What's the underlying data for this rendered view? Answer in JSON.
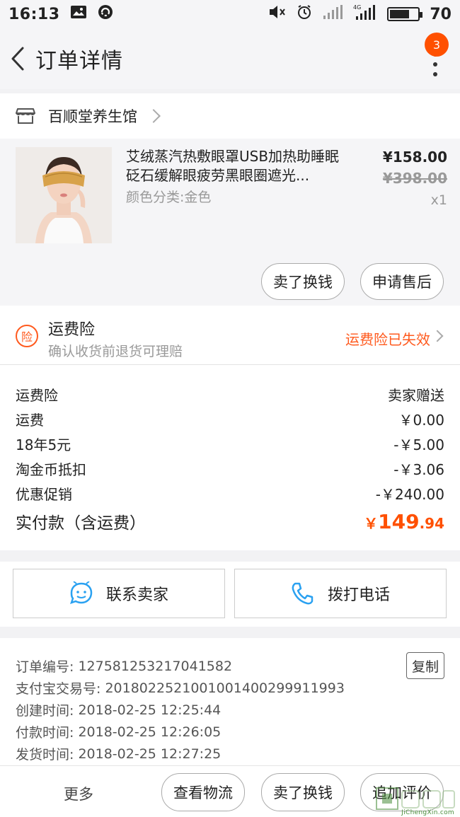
{
  "status_bar": {
    "time": "16:13",
    "battery": "70",
    "battery_level": 0.7
  },
  "header": {
    "title": "订单详情",
    "badge_count": "3"
  },
  "shop": {
    "name": "百顺堂养生馆"
  },
  "product": {
    "title": "艾绒蒸汽热敷眼罩USB加热助睡眠砭石缓解眼疲劳黑眼圈遮光...",
    "spec": "颜色分类:金色",
    "price": "¥158.00",
    "original_price": "¥398.00",
    "quantity": "x1",
    "buttons": {
      "sell": "卖了换钱",
      "after_sale": "申请售后"
    }
  },
  "insurance": {
    "icon_text": "险",
    "title": "运费险",
    "subtitle": "确认收货前退货可理赔",
    "status": "运费险已失效"
  },
  "costs": [
    {
      "label": "运费险",
      "value": "卖家赠送"
    },
    {
      "label": "运费",
      "value": "￥0.00"
    },
    {
      "label": "18年5元",
      "value": "-￥5.00"
    },
    {
      "label": "淘金币抵扣",
      "value": "-￥3.06"
    },
    {
      "label": "优惠促销",
      "value": "-￥240.00"
    }
  ],
  "total": {
    "label": "实付款（含运费）",
    "currency": "￥",
    "integer": "149",
    "decimal": ".94"
  },
  "contact": {
    "seller": "联系卖家",
    "call": "拨打电话"
  },
  "order_info": {
    "copy": "复制",
    "rows": [
      {
        "label": "订单编号:",
        "value": "127581253217041582"
      },
      {
        "label": "支付宝交易号:",
        "value": "2018022521001001400299911993"
      },
      {
        "label": "创建时间:",
        "value": "2018-02-25 12:25:44"
      },
      {
        "label": "付款时间:",
        "value": "2018-02-25 12:26:05"
      },
      {
        "label": "发货时间:",
        "value": "2018-02-25 12:27:25"
      }
    ]
  },
  "bottom_bar": {
    "more": "更多",
    "logistics": "查看物流",
    "sell": "卖了换钱",
    "review": "追加评价"
  },
  "watermark": {
    "text": "JiChengXin.com"
  },
  "colors": {
    "accent": "#ff5000",
    "insurance": "#ff5a1e",
    "chat_icon": "#2aa1f1"
  }
}
